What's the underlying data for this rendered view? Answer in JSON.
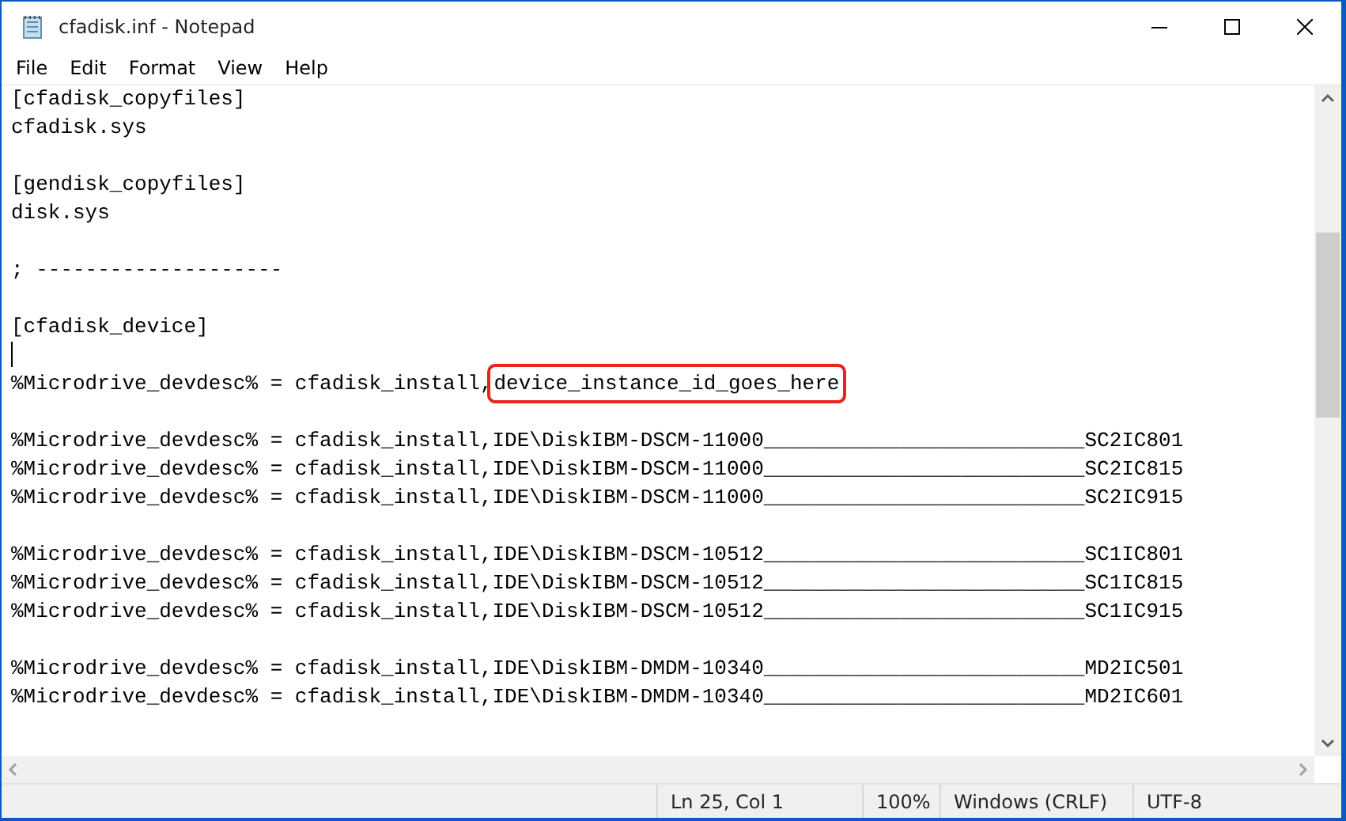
{
  "window": {
    "title": "cfadisk.inf - Notepad"
  },
  "menu": [
    "File",
    "Edit",
    "Format",
    "View",
    "Help"
  ],
  "editor": {
    "paragraphs": [
      [
        {
          "text": "[cfadisk_copyfiles]"
        },
        {
          "text": "cfadisk.sys"
        }
      ],
      [
        {
          "text": "[gendisk_copyfiles]"
        },
        {
          "text": "disk.sys"
        }
      ],
      [
        {
          "text": "; --------------------"
        }
      ],
      [
        {
          "text": "[cfadisk_device]"
        },
        {
          "caret": true
        },
        {
          "text": "%Microdrive_devdesc% = cfadisk_install,",
          "highlight": "device_instance_id_goes_here"
        }
      ],
      [
        {
          "text": "%Microdrive_devdesc% = cfadisk_install,IDE\\DiskIBM-DSCM-11000__________________________SC2IC801"
        },
        {
          "text": "%Microdrive_devdesc% = cfadisk_install,IDE\\DiskIBM-DSCM-11000__________________________SC2IC815"
        },
        {
          "text": "%Microdrive_devdesc% = cfadisk_install,IDE\\DiskIBM-DSCM-11000__________________________SC2IC915"
        }
      ],
      [
        {
          "text": "%Microdrive_devdesc% = cfadisk_install,IDE\\DiskIBM-DSCM-10512__________________________SC1IC801"
        },
        {
          "text": "%Microdrive_devdesc% = cfadisk_install,IDE\\DiskIBM-DSCM-10512__________________________SC1IC815"
        },
        {
          "text": "%Microdrive_devdesc% = cfadisk_install,IDE\\DiskIBM-DSCM-10512__________________________SC1IC915"
        }
      ],
      [
        {
          "text": "%Microdrive_devdesc% = cfadisk_install,IDE\\DiskIBM-DMDM-10340__________________________MD2IC501"
        },
        {
          "text": "%Microdrive_devdesc% = cfadisk_install,IDE\\DiskIBM-DMDM-10340__________________________MD2IC601"
        }
      ]
    ]
  },
  "status_bar": [
    "Ln 25, Col 1",
    "100%",
    "Windows (CRLF)",
    "UTF-8"
  ]
}
